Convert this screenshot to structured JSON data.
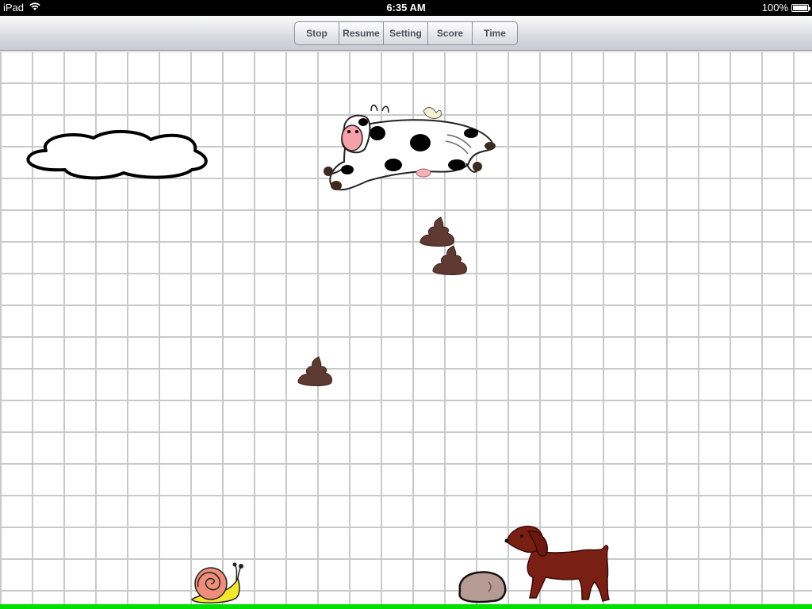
{
  "status_bar": {
    "device": "iPad",
    "time": "6:35 AM",
    "battery": "100%",
    "battery_level": 1.0
  },
  "toolbar": {
    "buttons": [
      "Stop",
      "Resume",
      "Setting",
      "Score",
      "Time"
    ]
  },
  "colors": {
    "ground": "#00e000",
    "grid": "#c9c9c9",
    "poop": "#5e3a33",
    "dog": "#7a1f14",
    "snail_shell": "#f08d7a",
    "snail_body": "#f5e62c",
    "rock": "#b69a94"
  },
  "icons": {
    "wifi": "wifi-icon",
    "battery": "battery-icon"
  }
}
